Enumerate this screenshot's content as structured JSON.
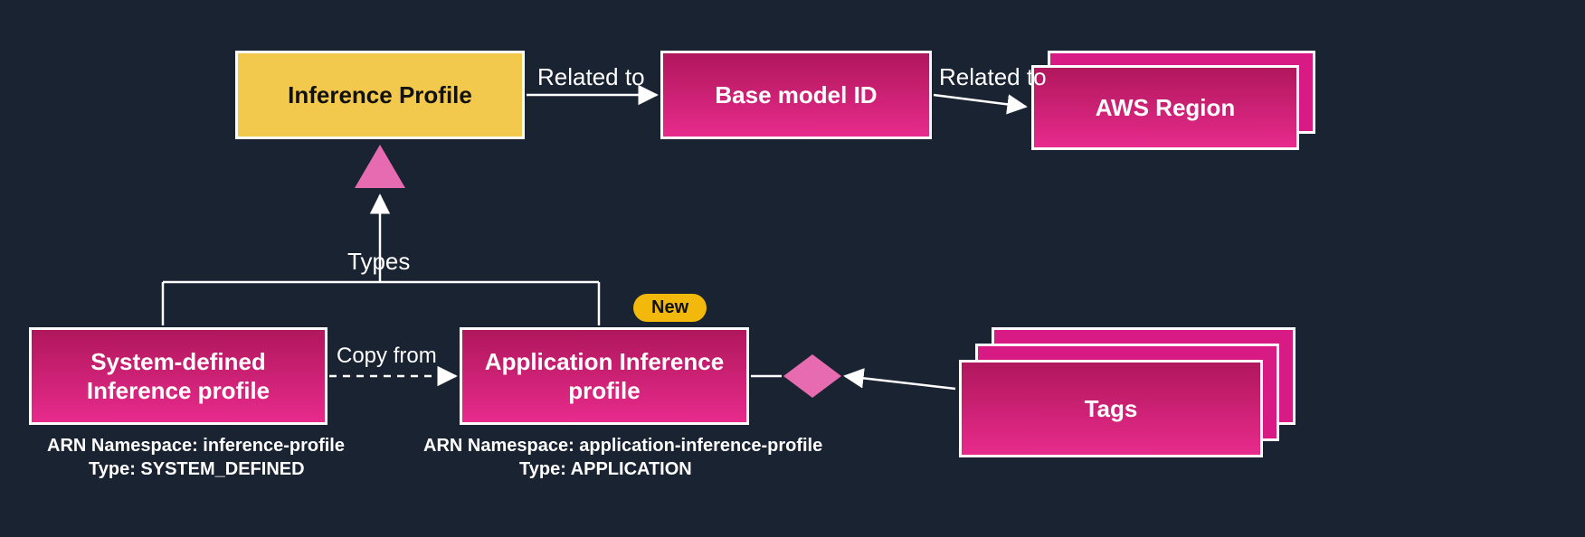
{
  "nodes": {
    "inference_profile": "Inference Profile",
    "base_model_id": "Base model ID",
    "aws_region": "AWS Region",
    "system_defined": "System-defined Inference profile",
    "application_profile": "Application Inference profile",
    "tags": "Tags"
  },
  "edges": {
    "related_to_1": "Related to",
    "related_to_2": "Related to",
    "types": "Types",
    "copy_from": "Copy from"
  },
  "badges": {
    "new": "New"
  },
  "annotations": {
    "system_defined_ns": "ARN Namespace: inference-profile",
    "system_defined_type": "Type: SYSTEM_DEFINED",
    "application_ns": "ARN Namespace: application-inference-profile",
    "application_type": "Type: APPLICATION"
  },
  "colors": {
    "background": "#1a2332",
    "yellow": "#f2c94c",
    "magenta_top": "#b0175c",
    "magenta_bottom": "#e72b8c",
    "pink_light": "#e76bb0",
    "white": "#ffffff"
  }
}
